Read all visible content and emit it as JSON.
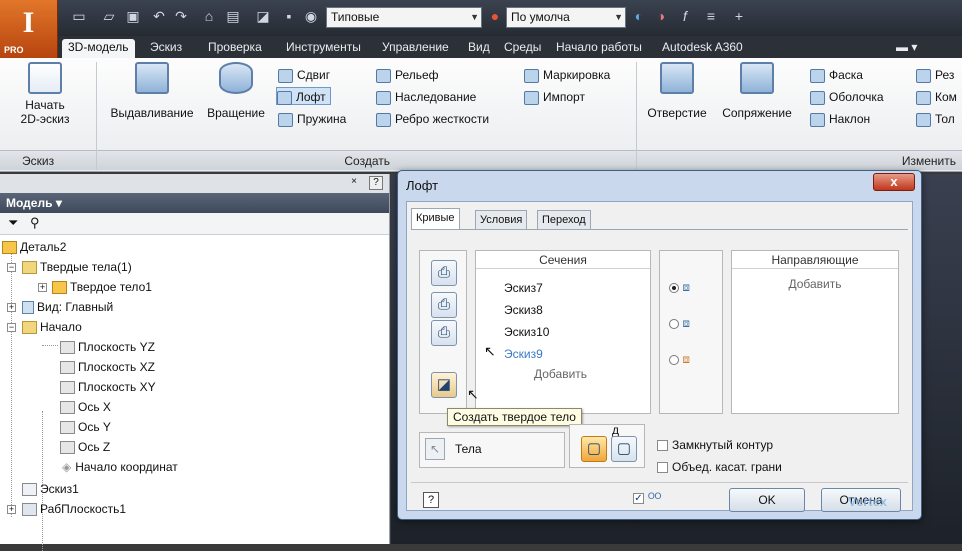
{
  "app": {
    "logo_letter": "I",
    "logo_badge": "PRO"
  },
  "quick_access": {
    "style_combo": "Типовые",
    "appearance_combo": "По умолча",
    "fx_symbol": "f"
  },
  "ribbon_tabs": [
    {
      "label": "3D-модель",
      "active": true
    },
    {
      "label": "Эскиз"
    },
    {
      "label": "Проверка"
    },
    {
      "label": "Инструменты"
    },
    {
      "label": "Управление"
    },
    {
      "label": "Вид"
    },
    {
      "label": "Среды"
    },
    {
      "label": "Начало работы"
    },
    {
      "label": "Autodesk A360"
    }
  ],
  "ribbon": {
    "sketch": {
      "start_label_1": "Начать",
      "start_label_2": "2D-эскиз",
      "panel": "Эскиз"
    },
    "create": {
      "extrude": "Выдавливание",
      "revolve": "Вращение",
      "sweep": "Сдвиг",
      "loft": "Лофт",
      "coil": "Пружина",
      "emboss": "Рельеф",
      "derive": "Наследование",
      "rib": "Ребро жесткости",
      "decal": "Маркировка",
      "import": "Импорт",
      "panel": "Создать"
    },
    "modify": {
      "hole": "Отверстие",
      "fillet": "Сопряжение",
      "chamfer": "Фаска",
      "shell": "Оболочка",
      "draft": "Наклон",
      "split": "Рез",
      "combine": "Ком",
      "thicken": "Тол",
      "panel": "Изменить"
    }
  },
  "browser": {
    "title": "Модель",
    "nodes": [
      {
        "label": "Деталь2"
      },
      {
        "label": "Твердые тела(1)"
      },
      {
        "label": "Твердое тело1"
      },
      {
        "label": "Вид: Главный"
      },
      {
        "label": "Начало"
      },
      {
        "label": "Плоскость YZ"
      },
      {
        "label": "Плоскость XZ"
      },
      {
        "label": "Плоскость XY"
      },
      {
        "label": "Ось X"
      },
      {
        "label": "Ось Y"
      },
      {
        "label": "Ось Z"
      },
      {
        "label": "Начало координат"
      },
      {
        "label": "Эскиз1"
      },
      {
        "label": "РабПлоскость1"
      }
    ]
  },
  "dialog": {
    "title": "Лофт",
    "close": "x",
    "tabs": [
      "Кривые",
      "Условия",
      "Переход"
    ],
    "sections": {
      "header": "Сечения",
      "items": [
        "Эскиз7",
        "Эскиз8",
        "Эскиз10",
        "Эскиз9"
      ],
      "add": "Добавить"
    },
    "rails": {
      "header": "Направляющие",
      "add": "Добавить"
    },
    "output": {
      "label": "Вывод",
      "tooltip": "Создать твердое тело"
    },
    "bodies": "Тела",
    "closed_loop": "Замкнутый контур",
    "merge_faces": "Объед. касат. грани",
    "ok": "OK",
    "cancel": "Отмена",
    "help": "?"
  },
  "watermark": "Vertex"
}
